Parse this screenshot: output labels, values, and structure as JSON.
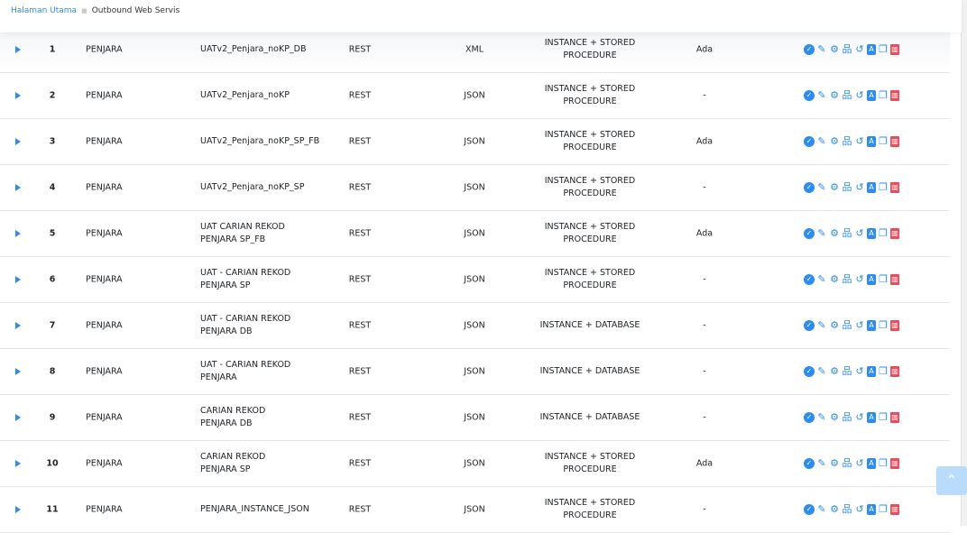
{
  "breadcrumb": {
    "home": "Halaman Utama",
    "current": "Outbound Web Servis"
  },
  "rows": [
    {
      "no": "1",
      "app": "PENJARA",
      "name": "UATv2_Penjara_noKP_DB",
      "protocol": "REST",
      "format": "XML",
      "type": "INSTANCE + STORED PROCEDURE",
      "ada": "Ada"
    },
    {
      "no": "2",
      "app": "PENJARA",
      "name": "UATv2_Penjara_noKP",
      "protocol": "REST",
      "format": "JSON",
      "type": "INSTANCE + STORED PROCEDURE",
      "ada": "-"
    },
    {
      "no": "3",
      "app": "PENJARA",
      "name": "UATv2_Penjara_noKP_SP_FB",
      "protocol": "REST",
      "format": "JSON",
      "type": "INSTANCE + STORED PROCEDURE",
      "ada": "Ada"
    },
    {
      "no": "4",
      "app": "PENJARA",
      "name": "UATv2_Penjara_noKP_SP",
      "protocol": "REST",
      "format": "JSON",
      "type": "INSTANCE + STORED PROCEDURE",
      "ada": "-"
    },
    {
      "no": "5",
      "app": "PENJARA",
      "name": "UAT CARIAN REKOD PENJARA SP_FB",
      "protocol": "REST",
      "format": "JSON",
      "type": "INSTANCE + STORED PROCEDURE",
      "ada": "Ada"
    },
    {
      "no": "6",
      "app": "PENJARA",
      "name": "UAT - CARIAN REKOD PENJARA SP",
      "protocol": "REST",
      "format": "JSON",
      "type": "INSTANCE + STORED PROCEDURE",
      "ada": "-"
    },
    {
      "no": "7",
      "app": "PENJARA",
      "name": "UAT - CARIAN REKOD PENJARA DB",
      "protocol": "REST",
      "format": "JSON",
      "type": "INSTANCE + DATABASE",
      "ada": "-"
    },
    {
      "no": "8",
      "app": "PENJARA",
      "name": "UAT - CARIAN REKOD PENJARA",
      "protocol": "REST",
      "format": "JSON",
      "type": "INSTANCE + DATABASE",
      "ada": "-"
    },
    {
      "no": "9",
      "app": "PENJARA",
      "name": "CARIAN REKOD PENJARA DB",
      "protocol": "REST",
      "format": "JSON",
      "type": "INSTANCE + DATABASE",
      "ada": "-"
    },
    {
      "no": "10",
      "app": "PENJARA",
      "name": "CARIAN REKOD PENJARA SP",
      "protocol": "REST",
      "format": "JSON",
      "type": "INSTANCE + STORED PROCEDURE",
      "ada": "Ada"
    },
    {
      "no": "11",
      "app": "PENJARA",
      "name": "PENJARA_INSTANCE_JSON",
      "protocol": "REST",
      "format": "JSON",
      "type": "INSTANCE + STORED PROCEDURE",
      "ada": "-"
    }
  ],
  "actions": [
    {
      "icon": "check-circle-icon",
      "glyph": "✓",
      "cls": "circ"
    },
    {
      "icon": "edit-icon",
      "glyph": "✎",
      "cls": ""
    },
    {
      "icon": "gear-icon",
      "glyph": "⚙",
      "cls": ""
    },
    {
      "icon": "sitemap-icon",
      "glyph": "品",
      "cls": ""
    },
    {
      "icon": "history-icon",
      "glyph": "↺",
      "cls": ""
    },
    {
      "icon": "pdf-icon",
      "glyph": "A",
      "cls": "box"
    },
    {
      "icon": "copy-icon",
      "glyph": "❐",
      "cls": ""
    },
    {
      "icon": "trash-icon",
      "glyph": "▥",
      "cls": "del"
    }
  ],
  "colors": {
    "accent": "#2d8cf0",
    "danger": "#ed4a5c"
  },
  "to_top_glyph": "⌃"
}
